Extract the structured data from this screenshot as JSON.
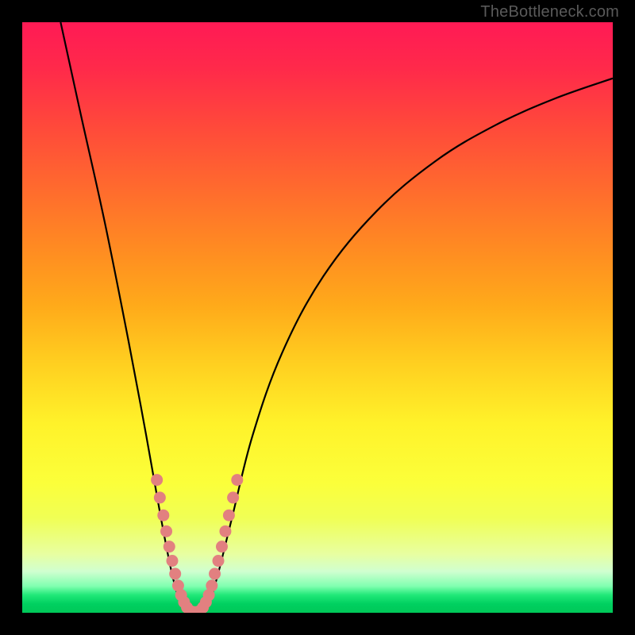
{
  "watermark": "TheBottleneck.com",
  "chart_data": {
    "type": "line",
    "title": "",
    "xlabel": "",
    "ylabel": "",
    "xlim": [
      0,
      100
    ],
    "ylim": [
      0,
      100
    ],
    "curve_left": {
      "description": "steep descending branch from top-left toward valley",
      "points": [
        {
          "x": 6.5,
          "y": 100
        },
        {
          "x": 10,
          "y": 84
        },
        {
          "x": 14,
          "y": 66
        },
        {
          "x": 18,
          "y": 46
        },
        {
          "x": 21,
          "y": 30
        },
        {
          "x": 23.5,
          "y": 16
        },
        {
          "x": 25.5,
          "y": 6
        },
        {
          "x": 27,
          "y": 1.5
        },
        {
          "x": 28.5,
          "y": 0.2
        }
      ]
    },
    "curve_right": {
      "description": "ascending branch from valley toward upper-right, flattening",
      "points": [
        {
          "x": 30,
          "y": 0.2
        },
        {
          "x": 31.5,
          "y": 1.5
        },
        {
          "x": 33,
          "y": 6
        },
        {
          "x": 35.5,
          "y": 16
        },
        {
          "x": 39,
          "y": 30
        },
        {
          "x": 44,
          "y": 44
        },
        {
          "x": 51,
          "y": 57
        },
        {
          "x": 60,
          "y": 68
        },
        {
          "x": 70,
          "y": 76.5
        },
        {
          "x": 80,
          "y": 82.5
        },
        {
          "x": 90,
          "y": 87
        },
        {
          "x": 100,
          "y": 90.5
        }
      ]
    },
    "markers": {
      "description": "salmon-colored dots/segments near valley on both branches",
      "color": "#e28080",
      "points_left": [
        {
          "x": 22.8,
          "y": 22.5
        },
        {
          "x": 23.3,
          "y": 19.5
        },
        {
          "x": 23.9,
          "y": 16.5
        },
        {
          "x": 24.4,
          "y": 13.8
        },
        {
          "x": 24.9,
          "y": 11.2
        },
        {
          "x": 25.4,
          "y": 8.8
        },
        {
          "x": 25.9,
          "y": 6.6
        },
        {
          "x": 26.4,
          "y": 4.6
        },
        {
          "x": 26.9,
          "y": 3.0
        },
        {
          "x": 27.4,
          "y": 1.8
        },
        {
          "x": 27.9,
          "y": 0.9
        }
      ],
      "points_right": [
        {
          "x": 30.6,
          "y": 0.9
        },
        {
          "x": 31.1,
          "y": 1.8
        },
        {
          "x": 31.6,
          "y": 3.0
        },
        {
          "x": 32.1,
          "y": 4.6
        },
        {
          "x": 32.6,
          "y": 6.6
        },
        {
          "x": 33.2,
          "y": 8.8
        },
        {
          "x": 33.8,
          "y": 11.2
        },
        {
          "x": 34.4,
          "y": 13.8
        },
        {
          "x": 35.0,
          "y": 16.5
        },
        {
          "x": 35.7,
          "y": 19.5
        },
        {
          "x": 36.4,
          "y": 22.5
        }
      ],
      "points_valley": [
        {
          "x": 28.4,
          "y": 0.4
        },
        {
          "x": 29.0,
          "y": 0.2
        },
        {
          "x": 29.6,
          "y": 0.2
        },
        {
          "x": 30.1,
          "y": 0.4
        }
      ]
    }
  }
}
